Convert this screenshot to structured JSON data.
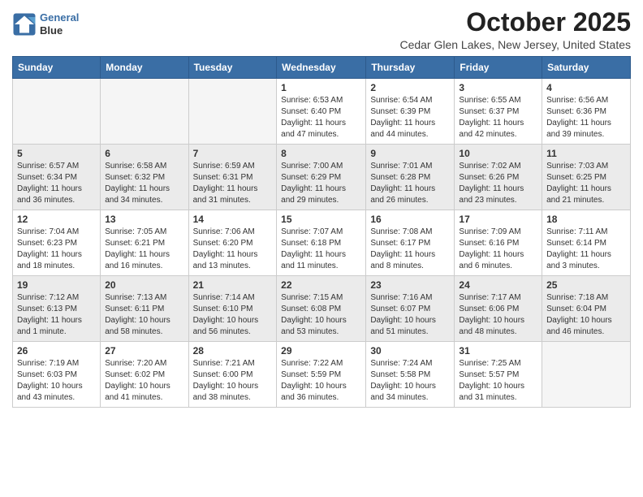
{
  "header": {
    "logo_line1": "General",
    "logo_line2": "Blue",
    "month_title": "October 2025",
    "location": "Cedar Glen Lakes, New Jersey, United States"
  },
  "weekdays": [
    "Sunday",
    "Monday",
    "Tuesday",
    "Wednesday",
    "Thursday",
    "Friday",
    "Saturday"
  ],
  "weeks": [
    [
      {
        "day": "",
        "info": ""
      },
      {
        "day": "",
        "info": ""
      },
      {
        "day": "",
        "info": ""
      },
      {
        "day": "1",
        "info": "Sunrise: 6:53 AM\nSunset: 6:40 PM\nDaylight: 11 hours\nand 47 minutes."
      },
      {
        "day": "2",
        "info": "Sunrise: 6:54 AM\nSunset: 6:39 PM\nDaylight: 11 hours\nand 44 minutes."
      },
      {
        "day": "3",
        "info": "Sunrise: 6:55 AM\nSunset: 6:37 PM\nDaylight: 11 hours\nand 42 minutes."
      },
      {
        "day": "4",
        "info": "Sunrise: 6:56 AM\nSunset: 6:36 PM\nDaylight: 11 hours\nand 39 minutes."
      }
    ],
    [
      {
        "day": "5",
        "info": "Sunrise: 6:57 AM\nSunset: 6:34 PM\nDaylight: 11 hours\nand 36 minutes."
      },
      {
        "day": "6",
        "info": "Sunrise: 6:58 AM\nSunset: 6:32 PM\nDaylight: 11 hours\nand 34 minutes."
      },
      {
        "day": "7",
        "info": "Sunrise: 6:59 AM\nSunset: 6:31 PM\nDaylight: 11 hours\nand 31 minutes."
      },
      {
        "day": "8",
        "info": "Sunrise: 7:00 AM\nSunset: 6:29 PM\nDaylight: 11 hours\nand 29 minutes."
      },
      {
        "day": "9",
        "info": "Sunrise: 7:01 AM\nSunset: 6:28 PM\nDaylight: 11 hours\nand 26 minutes."
      },
      {
        "day": "10",
        "info": "Sunrise: 7:02 AM\nSunset: 6:26 PM\nDaylight: 11 hours\nand 23 minutes."
      },
      {
        "day": "11",
        "info": "Sunrise: 7:03 AM\nSunset: 6:25 PM\nDaylight: 11 hours\nand 21 minutes."
      }
    ],
    [
      {
        "day": "12",
        "info": "Sunrise: 7:04 AM\nSunset: 6:23 PM\nDaylight: 11 hours\nand 18 minutes."
      },
      {
        "day": "13",
        "info": "Sunrise: 7:05 AM\nSunset: 6:21 PM\nDaylight: 11 hours\nand 16 minutes."
      },
      {
        "day": "14",
        "info": "Sunrise: 7:06 AM\nSunset: 6:20 PM\nDaylight: 11 hours\nand 13 minutes."
      },
      {
        "day": "15",
        "info": "Sunrise: 7:07 AM\nSunset: 6:18 PM\nDaylight: 11 hours\nand 11 minutes."
      },
      {
        "day": "16",
        "info": "Sunrise: 7:08 AM\nSunset: 6:17 PM\nDaylight: 11 hours\nand 8 minutes."
      },
      {
        "day": "17",
        "info": "Sunrise: 7:09 AM\nSunset: 6:16 PM\nDaylight: 11 hours\nand 6 minutes."
      },
      {
        "day": "18",
        "info": "Sunrise: 7:11 AM\nSunset: 6:14 PM\nDaylight: 11 hours\nand 3 minutes."
      }
    ],
    [
      {
        "day": "19",
        "info": "Sunrise: 7:12 AM\nSunset: 6:13 PM\nDaylight: 11 hours\nand 1 minute."
      },
      {
        "day": "20",
        "info": "Sunrise: 7:13 AM\nSunset: 6:11 PM\nDaylight: 10 hours\nand 58 minutes."
      },
      {
        "day": "21",
        "info": "Sunrise: 7:14 AM\nSunset: 6:10 PM\nDaylight: 10 hours\nand 56 minutes."
      },
      {
        "day": "22",
        "info": "Sunrise: 7:15 AM\nSunset: 6:08 PM\nDaylight: 10 hours\nand 53 minutes."
      },
      {
        "day": "23",
        "info": "Sunrise: 7:16 AM\nSunset: 6:07 PM\nDaylight: 10 hours\nand 51 minutes."
      },
      {
        "day": "24",
        "info": "Sunrise: 7:17 AM\nSunset: 6:06 PM\nDaylight: 10 hours\nand 48 minutes."
      },
      {
        "day": "25",
        "info": "Sunrise: 7:18 AM\nSunset: 6:04 PM\nDaylight: 10 hours\nand 46 minutes."
      }
    ],
    [
      {
        "day": "26",
        "info": "Sunrise: 7:19 AM\nSunset: 6:03 PM\nDaylight: 10 hours\nand 43 minutes."
      },
      {
        "day": "27",
        "info": "Sunrise: 7:20 AM\nSunset: 6:02 PM\nDaylight: 10 hours\nand 41 minutes."
      },
      {
        "day": "28",
        "info": "Sunrise: 7:21 AM\nSunset: 6:00 PM\nDaylight: 10 hours\nand 38 minutes."
      },
      {
        "day": "29",
        "info": "Sunrise: 7:22 AM\nSunset: 5:59 PM\nDaylight: 10 hours\nand 36 minutes."
      },
      {
        "day": "30",
        "info": "Sunrise: 7:24 AM\nSunset: 5:58 PM\nDaylight: 10 hours\nand 34 minutes."
      },
      {
        "day": "31",
        "info": "Sunrise: 7:25 AM\nSunset: 5:57 PM\nDaylight: 10 hours\nand 31 minutes."
      },
      {
        "day": "",
        "info": ""
      }
    ]
  ],
  "row_shading": [
    false,
    true,
    false,
    true,
    false
  ]
}
